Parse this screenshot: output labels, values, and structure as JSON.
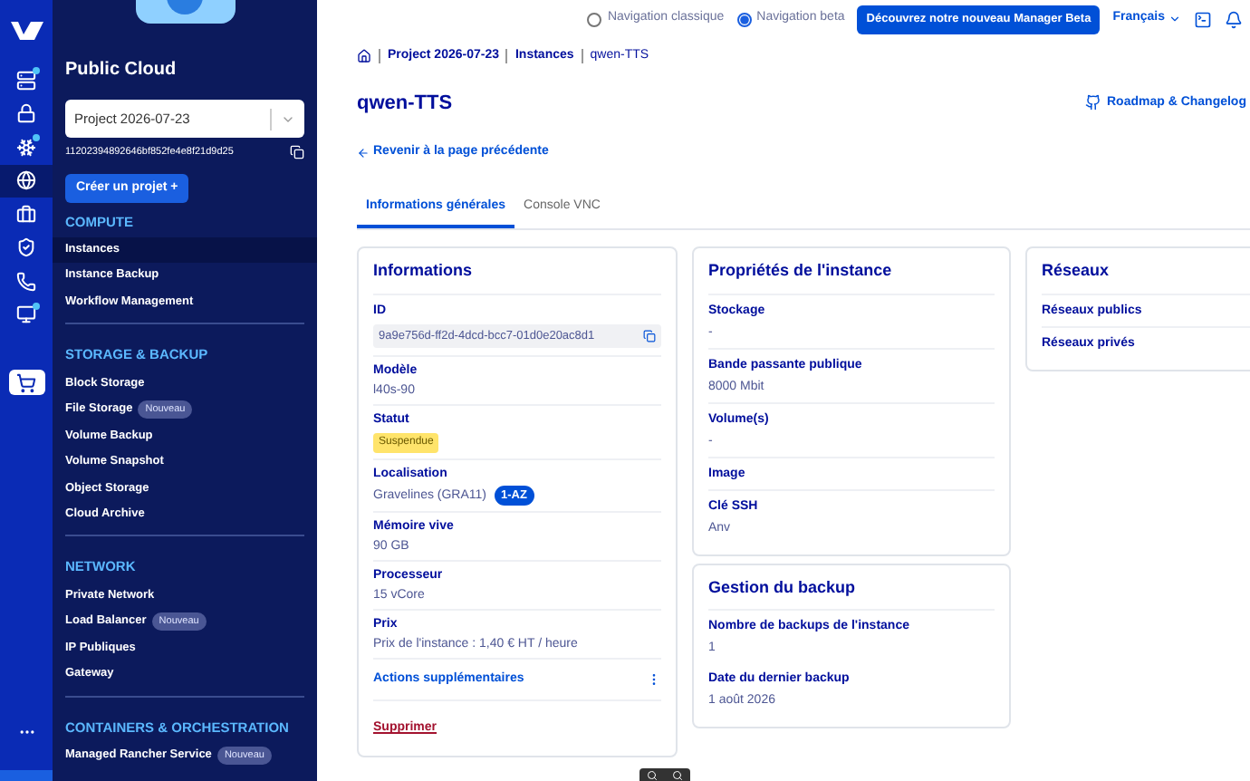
{
  "rail": [
    {
      "selected": false,
      "current": false,
      "notification": true
    },
    {
      "selected": false,
      "current": false,
      "notification": false
    },
    {
      "selected": false,
      "current": false,
      "notification": true
    },
    {
      "selected": false,
      "current": true,
      "notification": false
    },
    {
      "selected": false,
      "current": false,
      "notification": false
    },
    {
      "selected": false,
      "current": false,
      "notification": false
    },
    {
      "selected": false,
      "current": false,
      "notification": false
    },
    {
      "selected": false,
      "current": false,
      "notification": true
    },
    {
      "selected": true,
      "current": false,
      "notification": false
    }
  ],
  "sidebar": {
    "title": "Public Cloud",
    "project_select": {
      "value": "Project 2026-07-23"
    },
    "project_id": "11202394892646bf852fe4e8f21d9d25",
    "create_button": "Créer un projet +",
    "sections": [
      {
        "title": "COMPUTE",
        "items": [
          {
            "label": "Instances",
            "selected": true
          },
          {
            "label": "Instance Backup",
            "selected": false
          },
          {
            "label": "Workflow Management",
            "selected": false
          }
        ]
      },
      {
        "title": "STORAGE & BACKUP",
        "items": [
          {
            "label": "Block Storage",
            "selected": false
          },
          {
            "label": "File Storage",
            "selected": false,
            "badge": "Nouveau"
          },
          {
            "label": "Volume Backup",
            "selected": false
          },
          {
            "label": "Volume Snapshot",
            "selected": false
          },
          {
            "label": "Object Storage",
            "selected": false
          },
          {
            "label": "Cloud Archive",
            "selected": false
          }
        ]
      },
      {
        "title": "NETWORK",
        "items": [
          {
            "label": "Private Network",
            "selected": false
          },
          {
            "label": "Load Balancer",
            "selected": false,
            "badge": "Nouveau"
          },
          {
            "label": "IP Publiques",
            "selected": false
          },
          {
            "label": "Gateway",
            "selected": false
          }
        ]
      },
      {
        "title": "CONTAINERS & ORCHESTRATION",
        "items": [
          {
            "label": "Managed Rancher Service",
            "selected": false,
            "badge": "Nouveau"
          }
        ]
      }
    ]
  },
  "topbar": {
    "nav_options": [
      {
        "label": "Navigation classique",
        "selected": false
      },
      {
        "label": "Navigation beta",
        "selected": true
      }
    ],
    "beta_button": "Découvrez notre nouveau Manager Beta",
    "language": "Français"
  },
  "breadcrumb": [
    "Project 2026-07-23",
    "Instances",
    "qwen-TTS"
  ],
  "title": "qwen-TTS",
  "roadmap_link": "Roadmap & Changelog",
  "back_link": "Revenir à la page précédente",
  "tabs": [
    {
      "label": "Informations générales",
      "selected": true
    },
    {
      "label": "Console VNC",
      "selected": false
    }
  ],
  "info_card": {
    "title": "Informations",
    "id_label": "ID",
    "id_value": "9a9e756d-ff2d-4dcd-bcc7-01d0e20ac8d1",
    "fields": [
      {
        "label": "Modèle",
        "value": "l40s-90"
      },
      {
        "label": "Statut",
        "status": "Suspendue"
      },
      {
        "label": "Localisation",
        "value": "Gravelines (GRA11)",
        "badge": "1-AZ"
      },
      {
        "label": "Mémoire vive",
        "value": "90 GB"
      },
      {
        "label": "Processeur",
        "value": "15 vCore"
      },
      {
        "label": "Prix",
        "value": "Prix de l'instance : 1,40 € HT / heure"
      }
    ],
    "actions_link": "Actions supplémentaires",
    "delete_link": "Supprimer"
  },
  "properties_card": {
    "title": "Propriétés de l'instance",
    "fields": [
      {
        "label": "Stockage",
        "value": "-"
      },
      {
        "label": "Bande passante publique",
        "value": "8000 Mbit"
      },
      {
        "label": "Volume(s)",
        "value": "-"
      },
      {
        "label": "Image"
      },
      {
        "label": "Clé SSH",
        "value": "Anv"
      }
    ]
  },
  "backup_card": {
    "title": "Gestion du backup",
    "fields": [
      {
        "label": "Nombre de backups de l'instance",
        "value": "1"
      },
      {
        "label": "Date du dernier backup",
        "value": "1 août 2026"
      }
    ]
  },
  "networks_card": {
    "title": "Réseaux",
    "fields": [
      {
        "label": "Réseaux publics"
      },
      {
        "label": "Réseaux privés"
      }
    ]
  }
}
